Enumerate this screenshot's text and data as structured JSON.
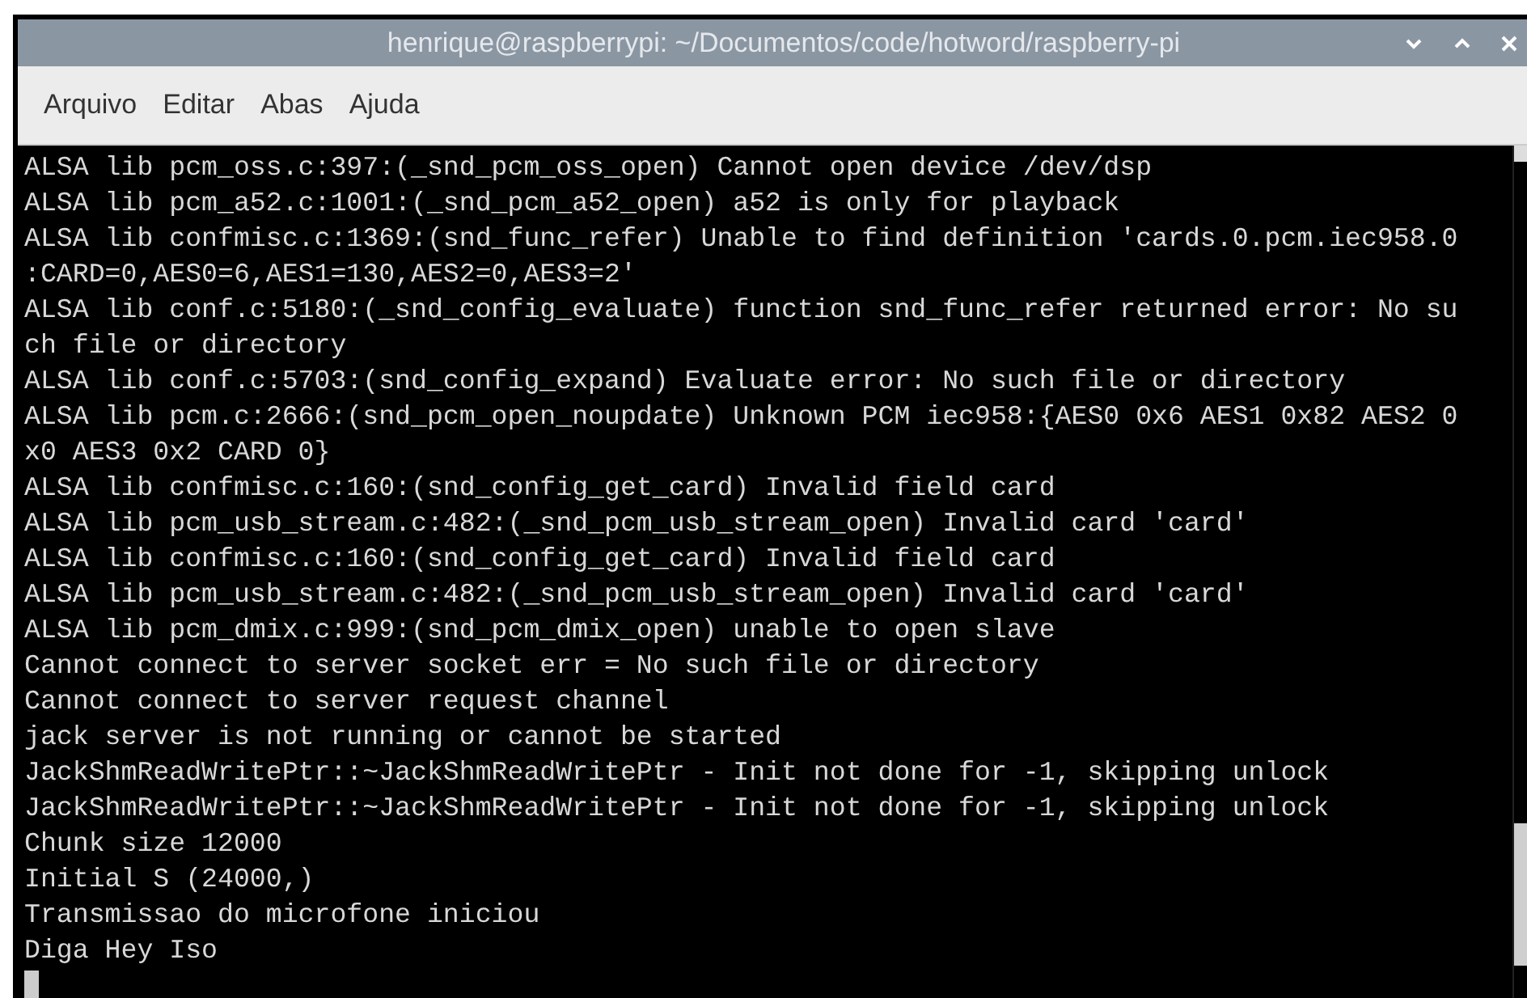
{
  "window": {
    "title": "henrique@raspberrypi: ~/Documentos/code/hotword/raspberry-pi"
  },
  "menu": [
    "Arquivo",
    "Editar",
    "Abas",
    "Ajuda"
  ],
  "terminal": {
    "lines": [
      "ALSA lib pcm_oss.c:397:(_snd_pcm_oss_open) Cannot open device /dev/dsp",
      "ALSA lib pcm_a52.c:1001:(_snd_pcm_a52_open) a52 is only for playback",
      "ALSA lib confmisc.c:1369:(snd_func_refer) Unable to find definition 'cards.0.pcm.iec958.0",
      ":CARD=0,AES0=6,AES1=130,AES2=0,AES3=2'",
      "ALSA lib conf.c:5180:(_snd_config_evaluate) function snd_func_refer returned error: No su",
      "ch file or directory",
      "ALSA lib conf.c:5703:(snd_config_expand) Evaluate error: No such file or directory",
      "ALSA lib pcm.c:2666:(snd_pcm_open_noupdate) Unknown PCM iec958:{AES0 0x6 AES1 0x82 AES2 0",
      "x0 AES3 0x2 CARD 0}",
      "ALSA lib confmisc.c:160:(snd_config_get_card) Invalid field card",
      "ALSA lib pcm_usb_stream.c:482:(_snd_pcm_usb_stream_open) Invalid card 'card'",
      "ALSA lib confmisc.c:160:(snd_config_get_card) Invalid field card",
      "ALSA lib pcm_usb_stream.c:482:(_snd_pcm_usb_stream_open) Invalid card 'card'",
      "ALSA lib pcm_dmix.c:999:(snd_pcm_dmix_open) unable to open slave",
      "Cannot connect to server socket err = No such file or directory",
      "Cannot connect to server request channel",
      "jack server is not running or cannot be started",
      "JackShmReadWritePtr::~JackShmReadWritePtr - Init not done for -1, skipping unlock",
      "JackShmReadWritePtr::~JackShmReadWritePtr - Init not done for -1, skipping unlock",
      "Chunk size 12000",
      "Initial S (24000,)",
      "Transmissao do microfone iniciou",
      "Diga Hey Iso"
    ]
  }
}
